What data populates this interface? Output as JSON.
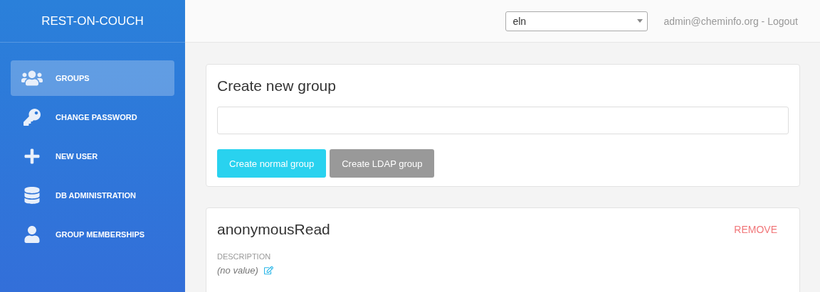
{
  "sidebar": {
    "title": "REST-ON-COUCH",
    "items": [
      {
        "kind": "groups",
        "label": "GROUPS",
        "selected": true
      },
      {
        "kind": "key",
        "label": "CHANGE PASSWORD",
        "selected": false
      },
      {
        "kind": "plus",
        "label": "NEW USER",
        "selected": false
      },
      {
        "kind": "database",
        "label": "DB ADMINISTRATION",
        "selected": false
      },
      {
        "kind": "user",
        "label": "GROUP MEMBERSHIPS",
        "selected": false
      }
    ]
  },
  "topbar": {
    "database_select": {
      "value": "eln"
    },
    "user": "admin@cheminfo.org - Logout"
  },
  "create_group": {
    "title": "Create new group",
    "buttons": [
      {
        "kind": "primary",
        "label": "Create normal group"
      },
      {
        "kind": "secondary",
        "label": "Create LDAP group"
      }
    ]
  },
  "group": {
    "name": "anonymousRead",
    "remove": "REMOVE",
    "description_label": "DESCRIPTION",
    "description_value": "(no value)"
  }
}
